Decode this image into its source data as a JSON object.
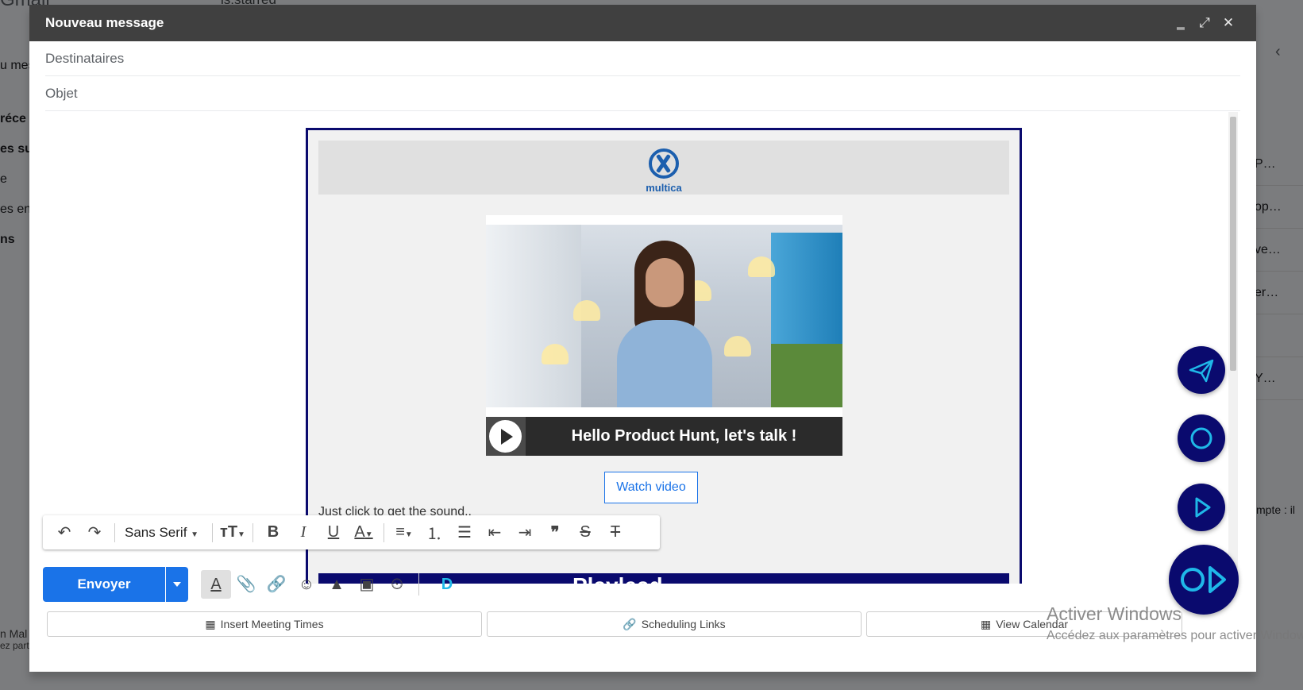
{
  "background": {
    "brand": "Gmail",
    "search_text": "is:starred",
    "left_items": [
      "u mes",
      "réce",
      "es su",
      "e",
      "es ent",
      "ns"
    ],
    "right_rows": [
      "P…",
      "op…",
      "ve…",
      "er…",
      "",
      "Y…"
    ],
    "right_text": "mpte : il",
    "bottom_lines": [
      "n Mal",
      "ez part"
    ]
  },
  "compose": {
    "title": "Nouveau message",
    "to_placeholder": "Destinataires",
    "subject_placeholder": "Objet",
    "email": {
      "logo_text": "multica",
      "video_caption": "Hello Product Hunt, let's talk !",
      "watch_button": "Watch video",
      "sound_text": "Just click to get the sound..",
      "band_text": "Playlead"
    },
    "format_toolbar": {
      "font": "Sans Serif"
    },
    "send_label": "Envoyer",
    "bottom_buttons": [
      "Insert Meeting Times",
      "Scheduling Links",
      "View Calendar"
    ]
  },
  "watermark": {
    "line1": "Activer Windows",
    "line2": "Accédez aux paramètres pour activer Windows."
  },
  "colors": {
    "titlebar": "#404040",
    "primary": "#1a73e8",
    "brand_navy": "#0a0a6e",
    "fab_accent": "#1fb8e8"
  }
}
